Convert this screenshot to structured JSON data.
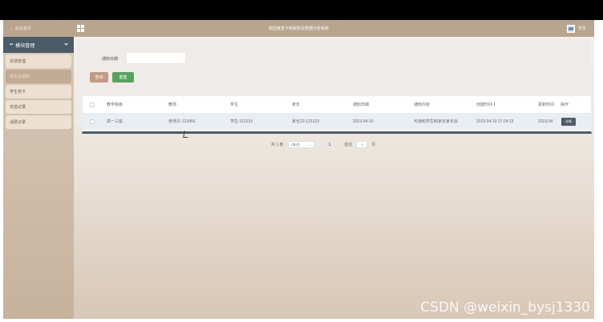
{
  "header": {
    "home_label": "后台首页",
    "system_title": "校园食堂卡校服务及数据分析系统",
    "user_label": "学生"
  },
  "sidebar": {
    "group_label": "模块管理",
    "items": [
      {
        "label": "反馈管理",
        "active": false
      },
      {
        "label": "家长会通知",
        "active": true
      },
      {
        "label": "学生校卡",
        "active": false
      },
      {
        "label": "充值记录",
        "active": false
      },
      {
        "label": "消费记录",
        "active": false
      }
    ]
  },
  "search": {
    "field_label": "通知日期",
    "field_value": "",
    "search_button": "查询",
    "reset_button": "重置"
  },
  "table": {
    "headers": [
      "教学班级",
      "教师",
      "学生",
      "家长",
      "通知日期",
      "通知内容",
      "创建时间",
      "更新时间",
      "操作"
    ],
    "rows": [
      {
        "class": "高一三班",
        "teacher": "老师11-123456",
        "student": "学生-112233",
        "parent": "家长22-123123",
        "notice_date": "2023-04-10",
        "content": "可通知学生和家长家长会",
        "created": "2023-04-10 17:24:13",
        "updated": "2023-04",
        "action": "详情"
      }
    ]
  },
  "pagination": {
    "total": "共 1 条",
    "page_size": "7条/页",
    "current_page": "1",
    "goto_prefix": "前往",
    "goto_value": "1",
    "goto_suffix": "页"
  },
  "watermark": "CSDN @weixin_bysj1330",
  "icons": {
    "home": "home-icon",
    "menu": "grid-icon",
    "user": "avatar-icon"
  },
  "colors": {
    "header_bg": "#b9a48e",
    "sidebar_group_bg": "#4b5b67",
    "search_button": "#c39a83",
    "reset_button": "#57a25e"
  }
}
